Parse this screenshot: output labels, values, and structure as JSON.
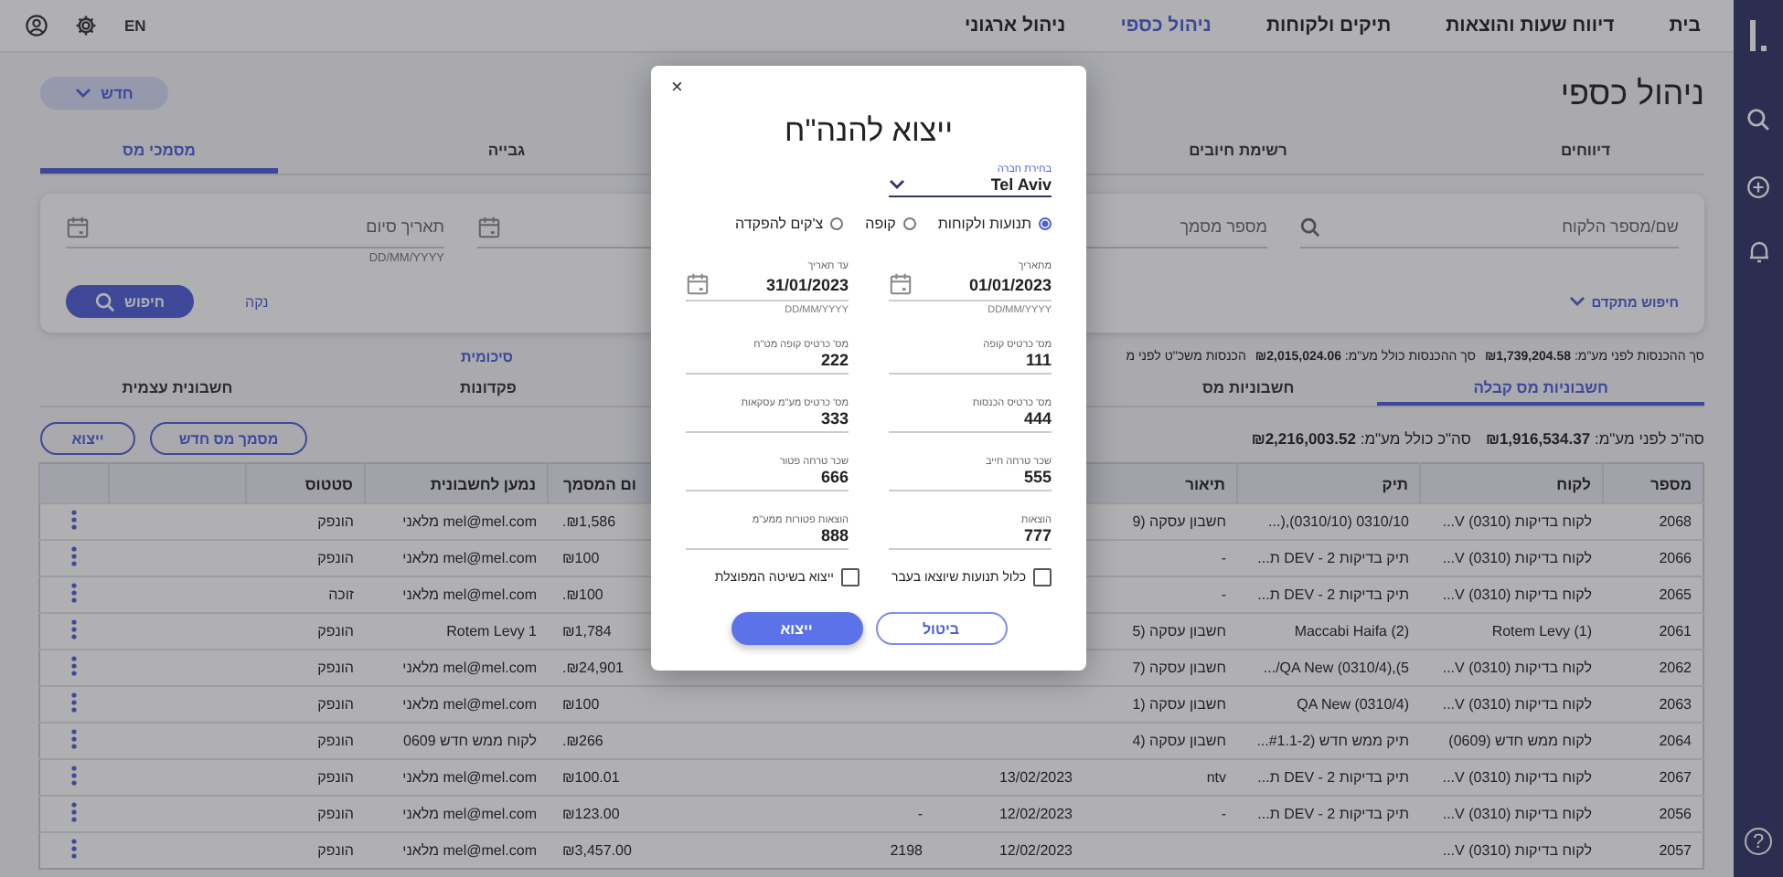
{
  "sidebar": {
    "help": "?"
  },
  "top_nav": {
    "items": [
      {
        "label": "בית",
        "selected": false
      },
      {
        "label": "דיווח שעות והוצאות",
        "selected": false
      },
      {
        "label": "תיקים ולקוחות",
        "selected": false
      },
      {
        "label": "ניהול כספי",
        "selected": true
      },
      {
        "label": "ניהול ארגוני",
        "selected": false
      }
    ],
    "language": "EN"
  },
  "page": {
    "title": "ניהול כספי",
    "new_button": "חדש"
  },
  "tabs": [
    {
      "label": "דיווחים",
      "selected": false
    },
    {
      "label": "רשימת חיובים",
      "selected": false
    },
    {
      "label": "גבייה",
      "selected": false
    },
    {
      "label": "מסמכי מס",
      "selected": true
    }
  ],
  "filters": {
    "fields": [
      {
        "kind": "search",
        "placeholder": "שם/מספר הלקוח"
      },
      {
        "kind": "text",
        "placeholder": "מספר מסמך"
      },
      {
        "kind": "date"
      },
      {
        "kind": "date",
        "placeholder": "תאריך סיום",
        "hint": "DD/MM/YYYY"
      }
    ],
    "advanced_search": "חיפוש מתקדם",
    "clear": "נקה",
    "search_button": "חיפוש"
  },
  "summary": {
    "items": [
      {
        "label": "סך ההכנסות לפני מע\"מ:",
        "value": "₪1,739,204.58"
      },
      {
        "label": "סך ההכנסות כולל מע\"מ:",
        "value": "₪2,015,024.06"
      },
      {
        "label": "הכנסות משכ\"ט לפני מ"
      }
    ],
    "link": "סיכומית"
  },
  "doc_tabs": [
    {
      "label": "חשבוניות מס קבלה",
      "selected": true
    },
    {
      "label": "חשבוניות מס",
      "selected": false
    },
    {
      "label": "פקדונות",
      "selected": false
    },
    {
      "label": "חשבונית עצמית",
      "selected": false
    }
  ],
  "actions": [
    "מסמך מס חדש",
    "ייצוא"
  ],
  "totals": [
    {
      "label": "סה\"כ לפני מע\"מ:",
      "value": "₪1,916,534.37"
    },
    {
      "label": "סה\"כ כולל מע\"מ:",
      "value": "₪2,216,003.52"
    }
  ],
  "table": {
    "columns": {
      "number": "מספר",
      "client": "לקוח",
      "case": "תיק",
      "description": "תיאור",
      "amount": "ום המסמך",
      "recipient": "נמען לחשבונית",
      "status": "סטטוס"
    },
    "rows": [
      {
        "number": "2068",
        "client": "לקוח בדיקות (0310) V...",
        "case": "0310/10 (0310/10),(...",
        "description": "חשבון עסקה (9",
        "amount": "₪1,586.",
        "recipient": "mel@mel.com מלאני",
        "status": "הונפק"
      },
      {
        "number": "2066",
        "client": "לקוח בדיקות (0310) V...",
        "case": "תיק בדיקות 2 - DEV ת...",
        "description": "-",
        "amount": "₪100",
        "recipient": "mel@mel.com מלאני",
        "status": "הונפק"
      },
      {
        "number": "2065",
        "client": "לקוח בדיקות (0310) V...",
        "case": "תיק בדיקות 2 - DEV ת...",
        "description": "-",
        "amount": "₪100.",
        "recipient": "mel@mel.com מלאני",
        "status": "זוכה"
      },
      {
        "number": "2061",
        "client": "Rotem Levy (1)",
        "case": "Maccabi Haifa (2)",
        "description": "חשבון עסקה (5",
        "amount": "₪1,784",
        "recipient": "Rotem Levy 1",
        "status": "הונפק"
      },
      {
        "number": "2062",
        "client": "לקוח בדיקות (0310) V...",
        "case": "QA New (0310/4),(5/...",
        "description": "חשבון עסקה (7",
        "amount": "₪24,901.",
        "recipient": "mel@mel.com מלאני",
        "status": "הונפק"
      },
      {
        "number": "2063",
        "client": "לקוח בדיקות (0310) V...",
        "case": "QA New (0310/4)",
        "description": "חשבון עסקה (1",
        "amount": "₪100",
        "recipient": "mel@mel.com מלאני",
        "status": "הונפק"
      },
      {
        "number": "2064",
        "client": "לקוח ממש חדש (0609)",
        "case": "תיק ממש חדש (#1.1-2...",
        "description": "חשבון עסקה (4",
        "amount": "₪266.",
        "recipient": "לקוח ממש חדש 0609",
        "status": "הונפק"
      },
      {
        "number": "2067",
        "client": "לקוח בדיקות (0310) V...",
        "case": "תיק בדיקות 2 - DEV ת...",
        "description": "ntv",
        "column_5": "13/02/2023",
        "amount": "₪100.01",
        "recipient": "mel@mel.com מלאני",
        "status": "הונפק"
      },
      {
        "number": "2056",
        "client": "לקוח בדיקות (0310) V...",
        "case": "תיק בדיקות 2 - DEV ת...",
        "description": "-",
        "column_5": "12/02/2023",
        "column_6": "-",
        "amount": "₪123.00",
        "recipient": "mel@mel.com מלאני",
        "status": "הונפק"
      },
      {
        "number": "2057",
        "client": "לקוח בדיקות (0310) V...",
        "column_5": "12/02/2023",
        "column_6": "2198",
        "amount": "₪3,457.00",
        "recipient": "mel@mel.com מלאני",
        "status": "הונפק"
      }
    ]
  },
  "dialog": {
    "close": "×",
    "title": "ייצוא להנה\"ח",
    "company": {
      "label": "בחירת חברה",
      "value": "Tel Aviv"
    },
    "report_types": [
      {
        "label": "תנועות ולקוחות",
        "selected": true
      },
      {
        "label": "קופה",
        "selected": false
      },
      {
        "label": "צ'קים להפקדה",
        "selected": false
      }
    ],
    "from_date": {
      "label": "מתאריך",
      "value": "01/01/2023",
      "hint": "DD/MM/YYYY"
    },
    "to_date": {
      "label": "עד תאריך",
      "value": "31/01/2023",
      "hint": "DD/MM/YYYY"
    },
    "fields": [
      {
        "label": "מס' כרטיס קופה",
        "value": "111"
      },
      {
        "label": "מס' כרטיס קופה מט\"ח",
        "value": "222"
      },
      {
        "label": "מס' כרטיס הכנסות",
        "value": "444"
      },
      {
        "label": "מס' כרטיס מע\"מ עסקאות",
        "value": "333"
      },
      {
        "label": "שכר טרחה חייב",
        "value": "555"
      },
      {
        "label": "שכר טרחה פטור",
        "value": "666"
      },
      {
        "label": "הוצאות",
        "value": "777"
      },
      {
        "label": "הוצאות פטורות ממע\"מ",
        "value": "888"
      }
    ],
    "checkboxes": [
      {
        "label": "כלול תנועות שיוצאו בעבר",
        "checked": false
      },
      {
        "label": "ייצוא בשיטה המפוצלת",
        "checked": false
      }
    ],
    "buttons": [
      {
        "label": "ביטול",
        "kind": "secondary"
      },
      {
        "label": "ייצוא",
        "kind": "primary"
      }
    ]
  }
}
